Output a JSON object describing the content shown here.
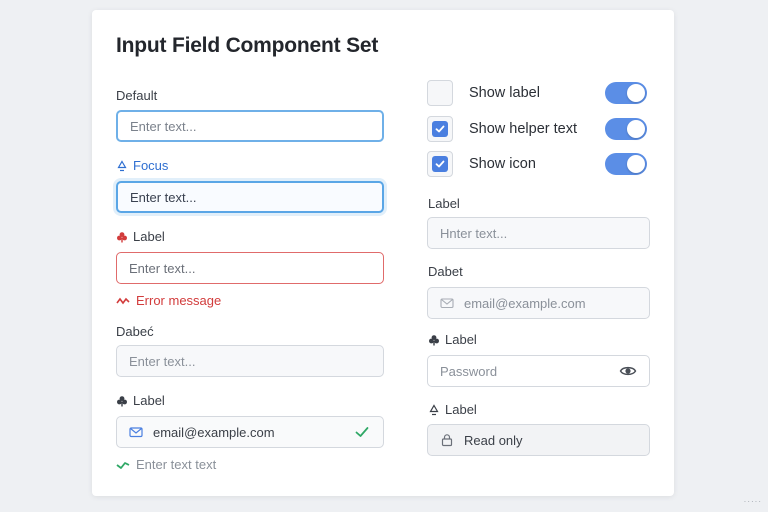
{
  "title": "Input Field Component Set",
  "left": {
    "default": {
      "label": "Default",
      "placeholder": "Enter text..."
    },
    "focus": {
      "label": "Focus",
      "value": "Enter text..."
    },
    "error": {
      "label": "Label",
      "placeholder": "Enter text...",
      "message": "Error message"
    },
    "disabled": {
      "label": "Dabeć",
      "placeholder": "Enter text..."
    },
    "valid": {
      "label": "Label",
      "value": "email@example.com",
      "message": "Enter text text"
    }
  },
  "right": {
    "options": [
      {
        "label": "Show label",
        "checked": false,
        "toggle": true
      },
      {
        "label": "Show helper text",
        "checked": true,
        "toggle": true
      },
      {
        "label": "Show icon",
        "checked": true,
        "toggle": true
      }
    ],
    "text": {
      "label": "Label",
      "placeholder": "Hnter text..."
    },
    "email": {
      "label": "Dabet",
      "placeholder": "email@example.com"
    },
    "password": {
      "label": "Label",
      "placeholder": "Password"
    },
    "readonly": {
      "label": "Label",
      "value": "Read only"
    }
  },
  "colors": {
    "accent": "#5b8ee6",
    "focus_border": "#5aa6e6",
    "error": "#d23c3c",
    "success": "#2fa866"
  },
  "icons": {
    "focus_label": "recycle-icon",
    "error_label": "club-icon",
    "valid_label": "club-icon",
    "email_field": "mail-icon",
    "valid_trailing": "check-icon",
    "error_msg": "wave-icon",
    "ok_msg": "check-icon",
    "password_trailing": "eye-icon",
    "readonly_field": "lock-icon"
  },
  "corner_text": "·····"
}
